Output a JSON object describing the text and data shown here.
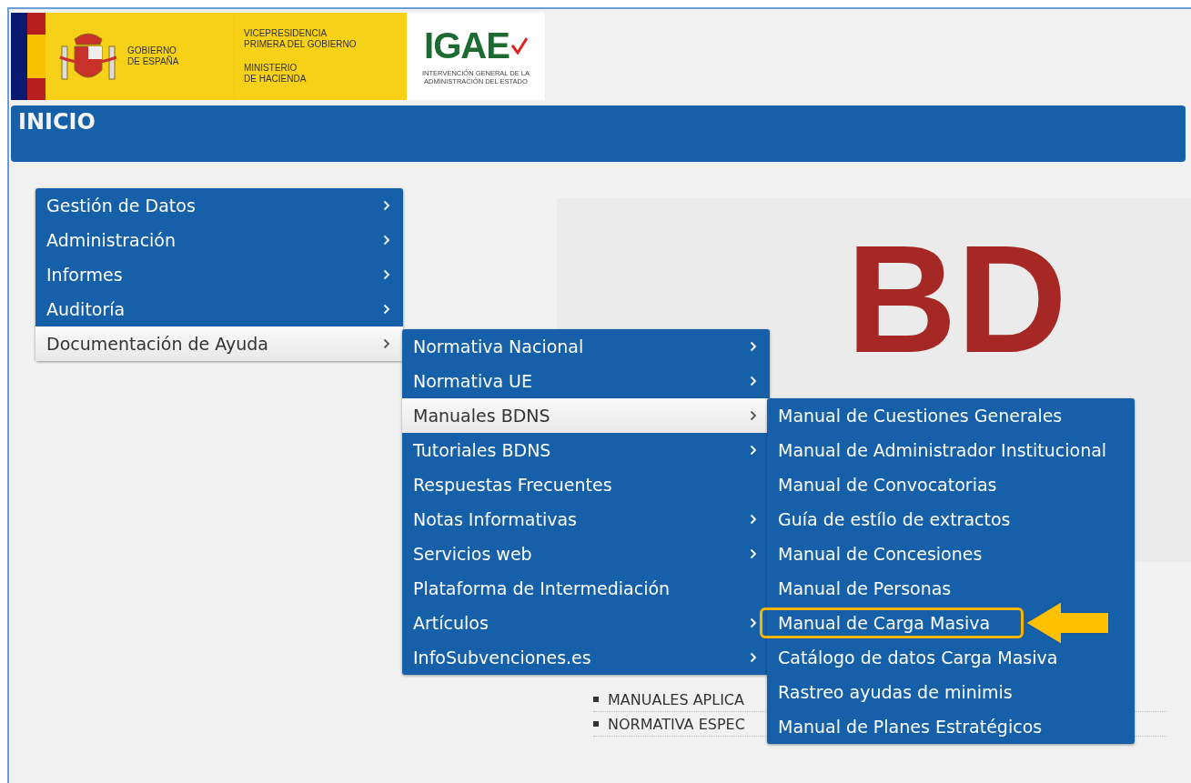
{
  "header": {
    "flag_logo": {
      "name_lines": [
        "GOBIERNO",
        "DE ESPAÑA"
      ]
    },
    "ministry": {
      "lines_top": [
        "VICEPRESIDENCIA",
        "PRIMERA DEL GOBIERNO"
      ],
      "lines_bottom": [
        "MINISTERIO",
        "DE HACIENDA"
      ]
    },
    "agency": {
      "acronym": "IGAE",
      "name_lines": [
        "INTERVENCIÓN GENERAL DE LA",
        "ADMINISTRACIÓN DEL ESTADO"
      ]
    }
  },
  "title_bar": {
    "title": "INICIO"
  },
  "hero": {
    "logo_lines": [
      "BD"
    ]
  },
  "links": [
    "MANUALES APLICA",
    "NORMATIVA ESPEC"
  ],
  "menus": [
    {
      "items": [
        {
          "label": "Gestión de Datos",
          "has_submenu": true,
          "selected": false
        },
        {
          "label": "Administración",
          "has_submenu": true,
          "selected": false
        },
        {
          "label": "Informes",
          "has_submenu": true,
          "selected": false
        },
        {
          "label": "Auditoría",
          "has_submenu": true,
          "selected": false
        },
        {
          "label": "Documentación de Ayuda",
          "has_submenu": true,
          "selected": true
        }
      ]
    },
    {
      "items": [
        {
          "label": "Normativa Nacional",
          "has_submenu": true,
          "selected": false
        },
        {
          "label": "Normativa UE",
          "has_submenu": true,
          "selected": false
        },
        {
          "label": "Manuales BDNS",
          "has_submenu": true,
          "selected": true
        },
        {
          "label": "Tutoriales BDNS",
          "has_submenu": true,
          "selected": false
        },
        {
          "label": "Respuestas Frecuentes",
          "has_submenu": false,
          "selected": false
        },
        {
          "label": "Notas Informativas",
          "has_submenu": true,
          "selected": false
        },
        {
          "label": "Servicios web",
          "has_submenu": true,
          "selected": false
        },
        {
          "label": "Plataforma de Intermediación",
          "has_submenu": false,
          "selected": false
        },
        {
          "label": "Artículos",
          "has_submenu": true,
          "selected": false
        },
        {
          "label": "InfoSubvenciones.es",
          "has_submenu": true,
          "selected": false
        }
      ]
    },
    {
      "items": [
        {
          "label": "Manual de Cuestiones Generales",
          "has_submenu": false,
          "selected": false,
          "highlighted": false
        },
        {
          "label": "Manual de Administrador Institucional",
          "has_submenu": false,
          "selected": false,
          "highlighted": false
        },
        {
          "label": "Manual de Convocatorias",
          "has_submenu": false,
          "selected": false,
          "highlighted": false
        },
        {
          "label": "Guía de estílo de extractos",
          "has_submenu": false,
          "selected": false,
          "highlighted": false
        },
        {
          "label": "Manual de Concesiones",
          "has_submenu": false,
          "selected": false,
          "highlighted": false
        },
        {
          "label": "Manual de Personas",
          "has_submenu": false,
          "selected": false,
          "highlighted": false
        },
        {
          "label": "Manual de Carga Masiva",
          "has_submenu": false,
          "selected": false,
          "highlighted": true
        },
        {
          "label": "Catálogo de datos Carga Masiva",
          "has_submenu": false,
          "selected": false,
          "highlighted": false
        },
        {
          "label": "Rastreo ayudas de minimis",
          "has_submenu": false,
          "selected": false,
          "highlighted": false
        },
        {
          "label": "Manual de Planes Estratégicos",
          "has_submenu": false,
          "selected": false,
          "highlighted": false
        }
      ]
    }
  ]
}
